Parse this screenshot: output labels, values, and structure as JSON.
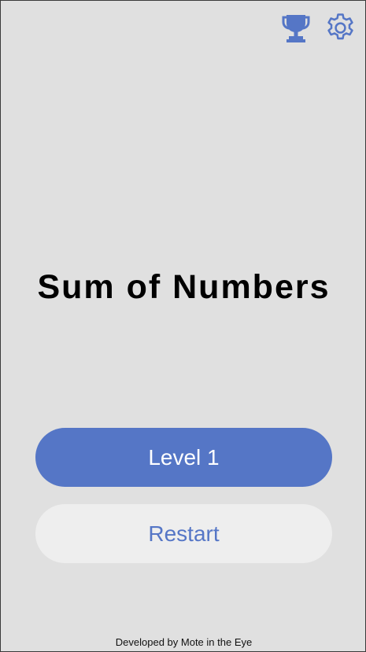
{
  "app": {
    "title": "Sum of Numbers"
  },
  "header": {
    "trophy_icon": "trophy-icon",
    "settings_icon": "gear-icon"
  },
  "buttons": {
    "level_label": "Level 1",
    "restart_label": "Restart"
  },
  "footer": {
    "credit": "Developed by Mote in the Eye"
  },
  "colors": {
    "background": "#e0e0e0",
    "accent": "#5576c6",
    "secondary_button": "#eeeeee",
    "title_text": "#000000"
  }
}
